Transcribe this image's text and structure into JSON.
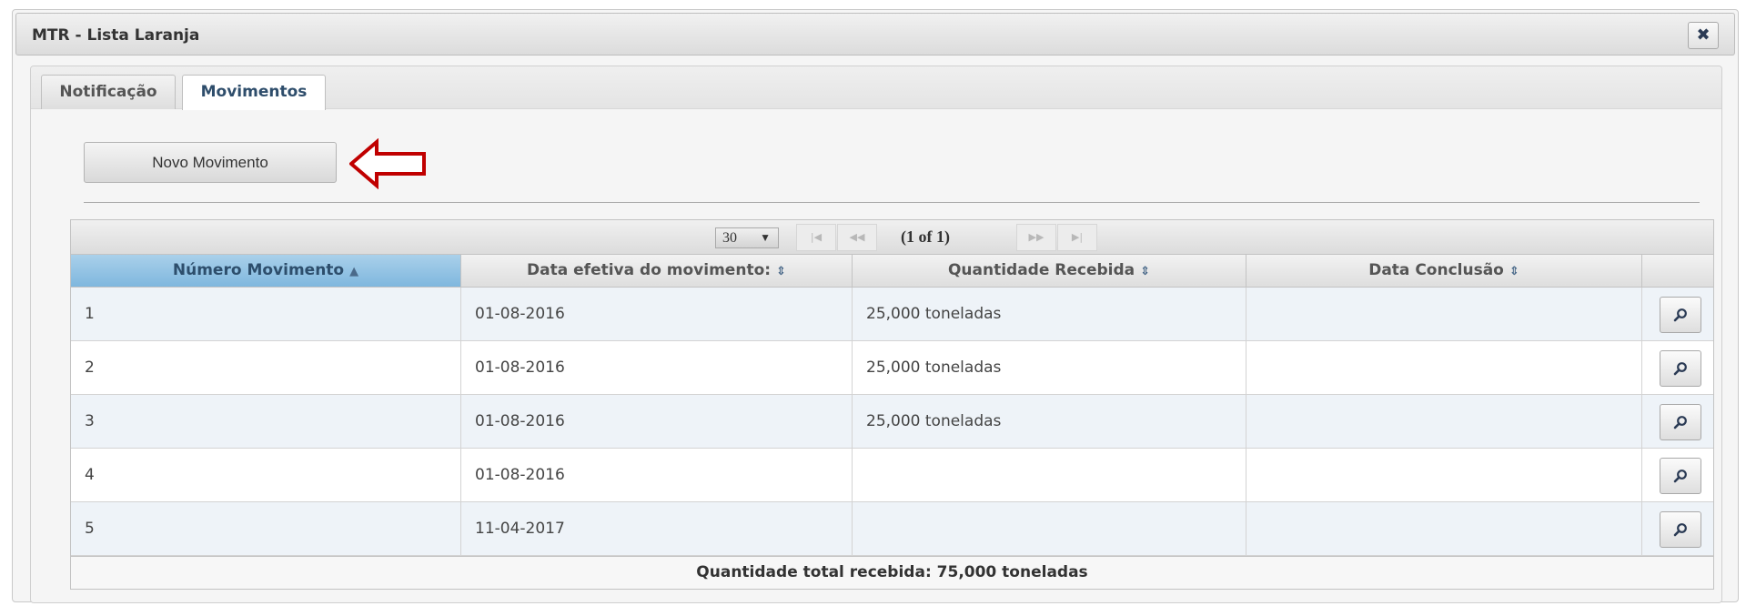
{
  "dialog": {
    "title": "MTR - Lista Laranja",
    "close_label": "✖"
  },
  "tabs": [
    {
      "label": "Notificação",
      "active": false
    },
    {
      "label": "Movimentos",
      "active": true
    }
  ],
  "toolbar": {
    "novo_label": "Novo Movimento"
  },
  "annotation": {
    "arrow_color": "#c00000",
    "arrow_icon": "arrow-left-outline-icon"
  },
  "paginator": {
    "rows_per_page": "30",
    "dropdown_icon": "▼",
    "current": "(1 of 1)",
    "first_icon": "▶|",
    "prev_icon": "◀◀",
    "next_icon": "▶▶",
    "last_icon": "▶|"
  },
  "table": {
    "columns": [
      {
        "label": "Número Movimento",
        "sort_icon": "▲"
      },
      {
        "label": "Data efetiva do movimento:",
        "sort_icon": "⇕"
      },
      {
        "label": "Quantidade Recebida",
        "sort_icon": "⇕"
      },
      {
        "label": "Data Conclusão",
        "sort_icon": "⇕"
      }
    ],
    "rows": [
      {
        "numero": "1",
        "data": "01-08-2016",
        "quantidade": "25,000 toneladas",
        "conclusao": ""
      },
      {
        "numero": "2",
        "data": "01-08-2016",
        "quantidade": "25,000 toneladas",
        "conclusao": ""
      },
      {
        "numero": "3",
        "data": "01-08-2016",
        "quantidade": "25,000 toneladas",
        "conclusao": ""
      },
      {
        "numero": "4",
        "data": "01-08-2016",
        "quantidade": "",
        "conclusao": ""
      },
      {
        "numero": "5",
        "data": "11-04-2017",
        "quantidade": "",
        "conclusao": ""
      }
    ],
    "row_action_icon": "magnifier-icon",
    "footer": "Quantidade total recebida: 75,000 toneladas"
  },
  "colors": {
    "sorted_header": "#7fb7de",
    "odd_row": "#eef3f8",
    "tab_active_text": "#2e4d6b"
  }
}
